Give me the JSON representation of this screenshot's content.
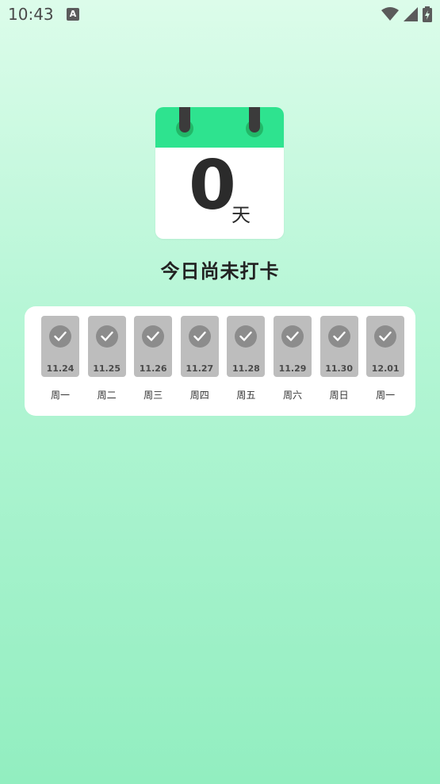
{
  "status_bar": {
    "time": "10:43",
    "notification_icon": "A"
  },
  "calendar": {
    "days": "0",
    "unit": "天"
  },
  "checkin_status": "今日尚未打卡",
  "week": [
    {
      "date": "11.24",
      "weekday": "周一"
    },
    {
      "date": "11.25",
      "weekday": "周二"
    },
    {
      "date": "11.26",
      "weekday": "周三"
    },
    {
      "date": "11.27",
      "weekday": "周四"
    },
    {
      "date": "11.28",
      "weekday": "周五"
    },
    {
      "date": "11.29",
      "weekday": "周六"
    },
    {
      "date": "11.30",
      "weekday": "周日"
    },
    {
      "date": "12.01",
      "weekday": "周一"
    }
  ],
  "colors": {
    "accent": "#2ee38f",
    "tile": "#bdbdbd"
  }
}
